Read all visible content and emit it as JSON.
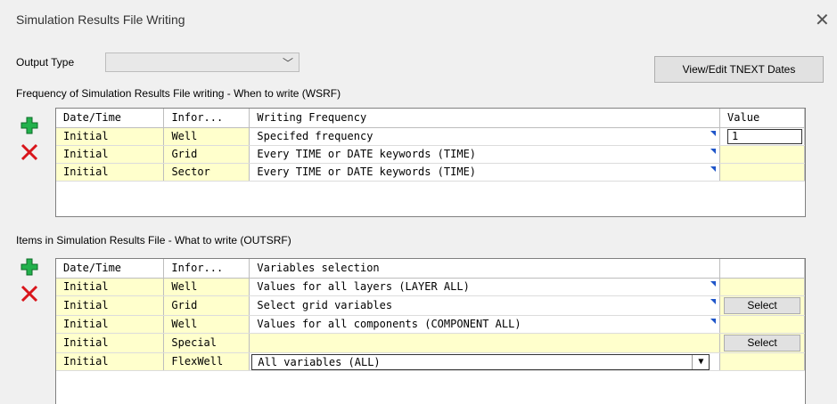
{
  "window": {
    "title": "Simulation Results File Writing"
  },
  "output_type": {
    "label": "Output Type",
    "value": ""
  },
  "tnext_button": "View/Edit TNEXT Dates",
  "wsrf": {
    "label": "Frequency of Simulation Results File writing -  When to write (WSRF)",
    "headers": [
      "Date/Time",
      "Infor...",
      "Writing Frequency",
      "Value"
    ],
    "rows": [
      {
        "date": "Initial",
        "info": "Well",
        "freq": "Specifed frequency",
        "value": "1"
      },
      {
        "date": "Initial",
        "info": "Grid",
        "freq": "Every TIME or DATE keywords (TIME)",
        "value": ""
      },
      {
        "date": "Initial",
        "info": "Sector",
        "freq": "Every TIME or DATE keywords (TIME)",
        "value": ""
      }
    ]
  },
  "outsrf": {
    "label": "Items in Simulation Results File - What to write (OUTSRF)",
    "headers": [
      "Date/Time",
      "Infor...",
      "Variables selection",
      ""
    ],
    "rows": [
      {
        "date": "Initial",
        "info": "Well",
        "vars": "Values for all layers (LAYER ALL)",
        "action": ""
      },
      {
        "date": "Initial",
        "info": "Grid",
        "vars": "Select grid variables",
        "action": "Select"
      },
      {
        "date": "Initial",
        "info": "Well",
        "vars": "Values for all components (COMPONENT ALL)",
        "action": ""
      },
      {
        "date": "Initial",
        "info": "Special",
        "vars": "",
        "action": "Select"
      },
      {
        "date": "Initial",
        "info": "FlexWell",
        "vars": "All variables (ALL)",
        "action": ""
      }
    ]
  },
  "icons": {
    "add": "plus-icon",
    "delete": "x-icon"
  },
  "colors": {
    "row_bg": "#ffffcc",
    "add": "#22b14c",
    "delete": "#d9151b",
    "dropdown_marker": "#1f55c9"
  }
}
